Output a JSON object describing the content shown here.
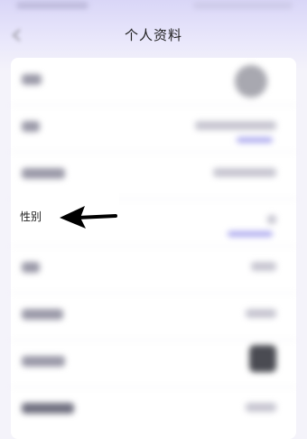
{
  "header": {
    "title": "个人资料"
  },
  "highlight": {
    "gender_label": "性别"
  },
  "colors": {
    "header_gradient": "#d9d6f7",
    "link": "#a9a6ee",
    "arrow": "#000000"
  },
  "icons": [
    "back-arrow-icon",
    "pointer-arrow-icon"
  ]
}
